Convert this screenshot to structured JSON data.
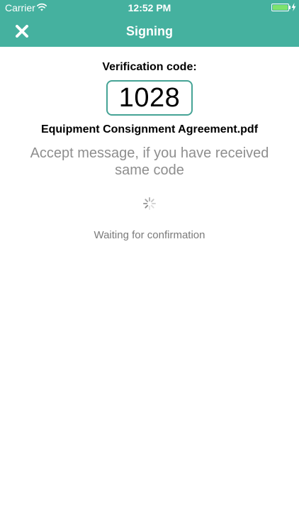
{
  "status_bar": {
    "carrier": "Carrier",
    "time": "12:52 PM",
    "icons": [
      "wifi-icon",
      "battery-icon",
      "charging-bolt-icon"
    ],
    "battery_color": "#7ee26d"
  },
  "nav": {
    "title": "Signing",
    "close_icon": "close-icon",
    "background": "#45b19f"
  },
  "verification": {
    "label": "Verification code:",
    "code": "1028",
    "border_color": "#45a395"
  },
  "document": {
    "name": "Equipment Consignment Agreement.pdf"
  },
  "instruction": "Accept message, if you have received same code",
  "status": {
    "spinner_icon": "spinner-icon",
    "text": "Waiting for confirmation"
  }
}
